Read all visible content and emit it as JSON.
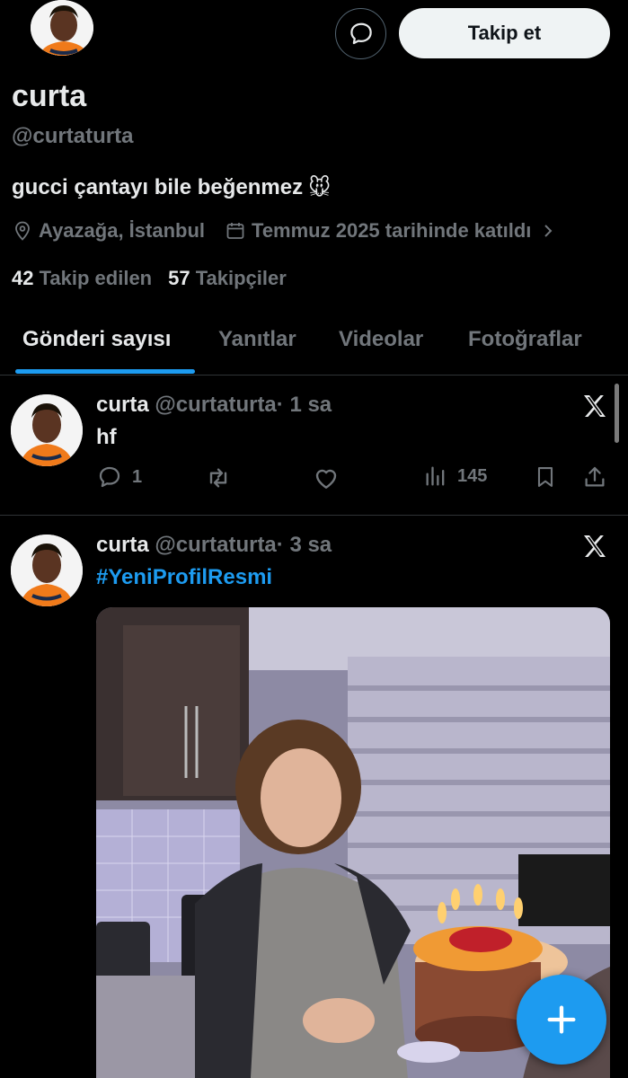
{
  "header": {
    "follow_label": "Takip et"
  },
  "profile": {
    "name": "curta",
    "handle": "@curtaturta",
    "bio": "gucci çantayı bile beğenmez",
    "bio_emoji": "🐭",
    "location": "Ayazağa, İstanbul",
    "joined": "Temmuz 2025 tarihinde katıldı",
    "following_count": "42",
    "following_label": "Takip edilen",
    "followers_count": "57",
    "followers_label": "Takipçiler"
  },
  "tabs": [
    {
      "label": "Gönderi sayısı",
      "active": true
    },
    {
      "label": "Yanıtlar"
    },
    {
      "label": "Videolar"
    },
    {
      "label": "Fotoğraflar"
    }
  ],
  "posts": [
    {
      "name": "curta",
      "handle": "@curtaturta",
      "time": "· 1 sa",
      "text": "hf",
      "replies": "1",
      "views": "145"
    },
    {
      "name": "curta",
      "handle": "@curtaturta",
      "time": "· 3 sa",
      "text": "#YeniProfilResmi"
    }
  ],
  "colors": {
    "accent": "#1d9bf0",
    "background": "#000000",
    "muted": "#71767b"
  }
}
